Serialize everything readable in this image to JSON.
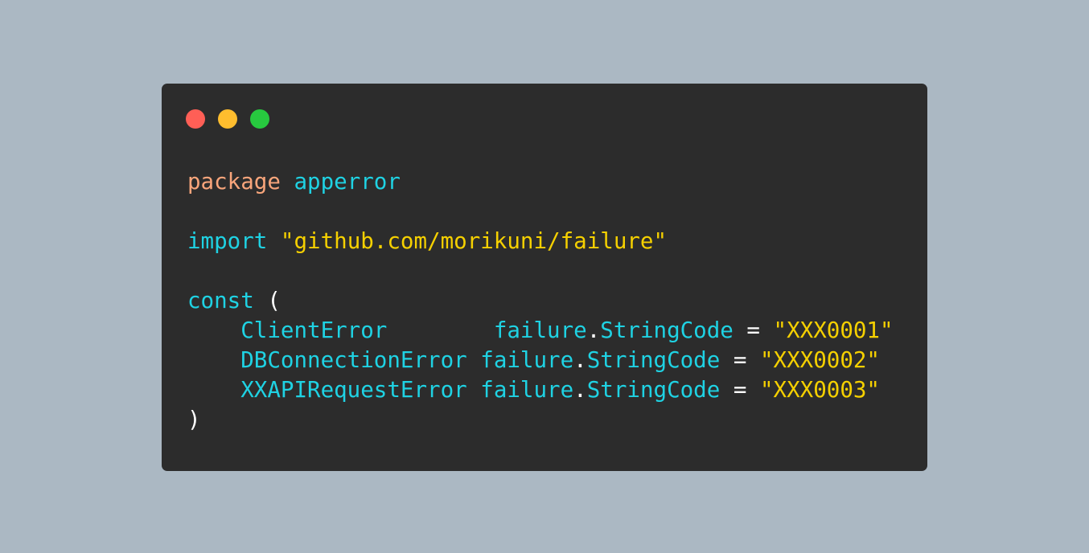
{
  "window": {
    "controls": [
      {
        "name": "close-dot",
        "color": "#ff5f56"
      },
      {
        "name": "minimize-dot",
        "color": "#ffbd2e"
      },
      {
        "name": "maximize-dot",
        "color": "#27c93f"
      }
    ]
  },
  "colors": {
    "background": "#abb8c3",
    "window": "#2c2c2c",
    "keyword_package": "#f8a57b",
    "identifier": "#1fd2e3",
    "string": "#f5d000",
    "plain": "#ffffff"
  },
  "code": {
    "lines": [
      [
        {
          "text": "package",
          "token": "keyword_package"
        },
        {
          "text": " ",
          "token": "plain"
        },
        {
          "text": "apperror",
          "token": "identifier"
        }
      ],
      [],
      [
        {
          "text": "import",
          "token": "identifier"
        },
        {
          "text": " ",
          "token": "plain"
        },
        {
          "text": "\"github.com/morikuni/failure\"",
          "token": "string"
        }
      ],
      [],
      [
        {
          "text": "const",
          "token": "identifier"
        },
        {
          "text": " (",
          "token": "plain"
        }
      ],
      [
        {
          "text": "    ",
          "token": "plain"
        },
        {
          "text": "ClientError",
          "token": "identifier"
        },
        {
          "text": "        ",
          "token": "plain"
        },
        {
          "text": "failure",
          "token": "identifier"
        },
        {
          "text": ".",
          "token": "plain"
        },
        {
          "text": "StringCode",
          "token": "identifier"
        },
        {
          "text": " = ",
          "token": "plain"
        },
        {
          "text": "\"XXX0001\"",
          "token": "string"
        }
      ],
      [
        {
          "text": "    ",
          "token": "plain"
        },
        {
          "text": "DBConnectionError",
          "token": "identifier"
        },
        {
          "text": " ",
          "token": "plain"
        },
        {
          "text": "failure",
          "token": "identifier"
        },
        {
          "text": ".",
          "token": "plain"
        },
        {
          "text": "StringCode",
          "token": "identifier"
        },
        {
          "text": " = ",
          "token": "plain"
        },
        {
          "text": "\"XXX0002\"",
          "token": "string"
        }
      ],
      [
        {
          "text": "    ",
          "token": "plain"
        },
        {
          "text": "XXAPIRequestError",
          "token": "identifier"
        },
        {
          "text": " ",
          "token": "plain"
        },
        {
          "text": "failure",
          "token": "identifier"
        },
        {
          "text": ".",
          "token": "plain"
        },
        {
          "text": "StringCode",
          "token": "identifier"
        },
        {
          "text": " = ",
          "token": "plain"
        },
        {
          "text": "\"XXX0003\"",
          "token": "string"
        }
      ],
      [
        {
          "text": ")",
          "token": "plain"
        }
      ]
    ]
  }
}
